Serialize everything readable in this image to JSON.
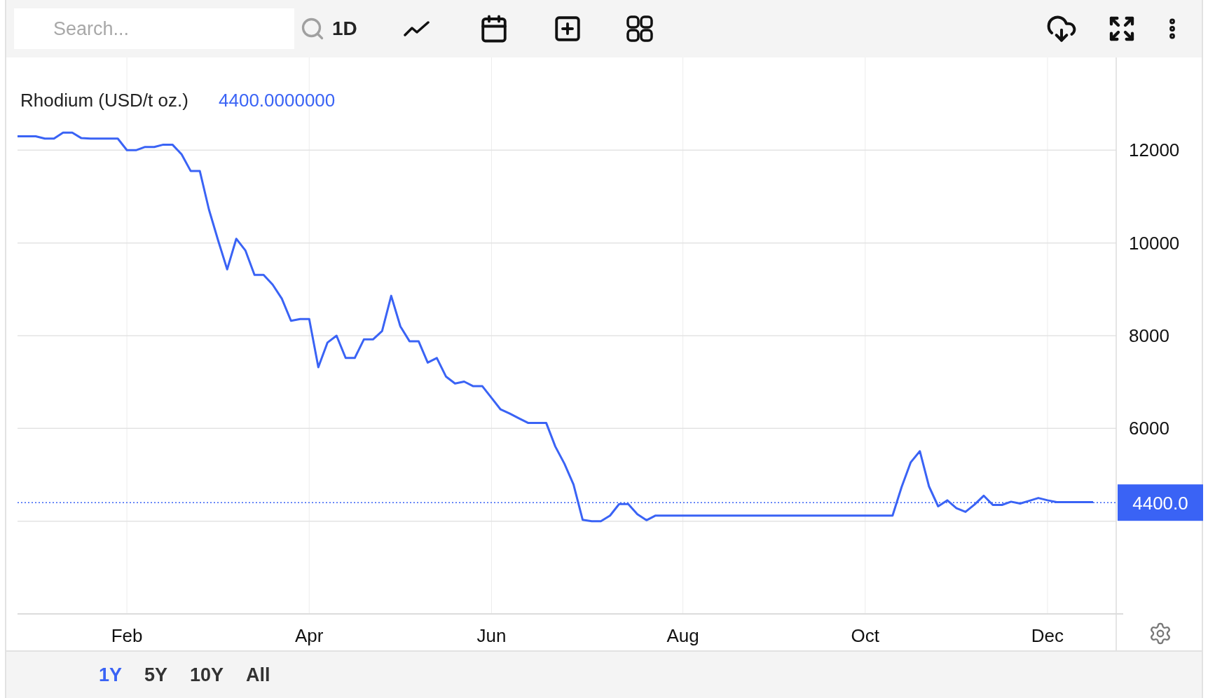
{
  "toolbar": {
    "search": {
      "placeholder": "Search..."
    },
    "interval": "1D"
  },
  "chart": {
    "current_value": "4400.0000000",
    "chart_data": {
      "type": "line",
      "grid": true,
      "categories": [
        null,
        null,
        null,
        null,
        null,
        null,
        null,
        null,
        null,
        null,
        null,
        null,
        "Feb",
        null,
        null,
        null,
        null,
        null,
        null,
        null,
        null,
        null,
        null,
        null,
        null,
        null,
        null,
        null,
        null,
        null,
        null,
        null,
        "Apr",
        null,
        null,
        null,
        null,
        null,
        null,
        null,
        null,
        null,
        null,
        null,
        null,
        null,
        null,
        null,
        null,
        null,
        null,
        null,
        "Jun",
        null,
        null,
        null,
        null,
        null,
        null,
        null,
        null,
        null,
        null,
        null,
        null,
        null,
        null,
        null,
        null,
        null,
        null,
        null,
        null,
        "Aug",
        null,
        null,
        null,
        null,
        null,
        null,
        null,
        null,
        null,
        null,
        null,
        null,
        null,
        null,
        null,
        null,
        null,
        null,
        null,
        "Oct",
        null,
        null,
        null,
        null,
        null,
        null,
        null,
        null,
        null,
        null,
        null,
        null,
        null,
        null,
        null,
        null,
        null,
        null,
        null,
        "Dec",
        null,
        null,
        null,
        null,
        null
      ],
      "series": [
        {
          "name": "Rhodium (USD/t oz.)",
          "color": "#3a63f5",
          "values": [
            12300,
            12300,
            12300,
            12250,
            12250,
            12380,
            12380,
            12260,
            12250,
            12250,
            12250,
            12250,
            12000,
            12000,
            12070,
            12070,
            12120,
            12120,
            11910,
            11550,
            11550,
            10720,
            10060,
            9430,
            10090,
            9840,
            9310,
            9310,
            9100,
            8800,
            8320,
            8360,
            8360,
            7320,
            7850,
            8000,
            7520,
            7520,
            7920,
            7920,
            8100,
            8860,
            8200,
            7880,
            7880,
            7420,
            7520,
            7120,
            6970,
            7010,
            6910,
            6910,
            6660,
            6410,
            6320,
            6220,
            6120,
            6120,
            6120,
            5610,
            5240,
            4790,
            4030,
            4000,
            4000,
            4120,
            4370,
            4370,
            4150,
            4020,
            4120,
            4120,
            4120,
            4120,
            4120,
            4120,
            4120,
            4120,
            4120,
            4120,
            4120,
            4120,
            4120,
            4120,
            4120,
            4120,
            4120,
            4120,
            4120,
            4120,
            4120,
            4120,
            4120,
            4120,
            4120,
            4120,
            4120,
            4740,
            5270,
            5510,
            4750,
            4320,
            4450,
            4280,
            4200,
            4360,
            4550,
            4350,
            4350,
            4420,
            4380,
            4440,
            4500,
            4450,
            4410,
            4410,
            4410,
            4410,
            4410
          ]
        }
      ],
      "ylim": [
        2000,
        14000
      ],
      "yticks": [
        6000,
        8000,
        10000,
        12000
      ],
      "ref_lines": [
        {
          "axis": "y",
          "value": 4400,
          "label": "4400.0"
        }
      ]
    }
  },
  "ranges": [
    {
      "label": "1Y",
      "selected": true
    },
    {
      "label": "5Y",
      "selected": false
    },
    {
      "label": "10Y",
      "selected": false
    },
    {
      "label": "All",
      "selected": false
    }
  ]
}
